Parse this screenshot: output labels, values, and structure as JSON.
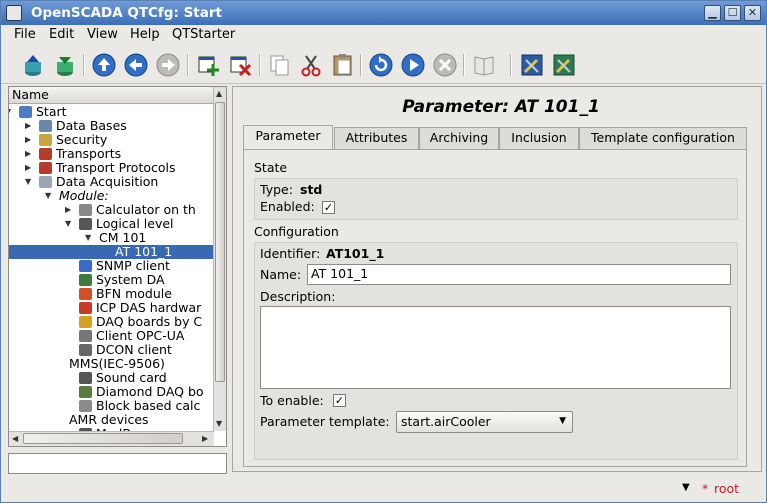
{
  "window": {
    "title": "OpenSCADA QTCfg: Start",
    "min": "▁",
    "max": "☐",
    "close": "✕"
  },
  "menu": [
    "File",
    "Edit",
    "View",
    "Help",
    "QTStarter"
  ],
  "toolbar": {
    "icons": [
      "db-load-icon",
      "db-save-icon",
      "up-icon",
      "back-icon",
      "forward-icon",
      "add-icon",
      "delete-icon",
      "copy-icon",
      "cut-icon",
      "paste-icon",
      "refresh-icon",
      "start-icon",
      "stop-icon",
      "manual-icon",
      "tool-icon-1",
      "tool-icon-2"
    ]
  },
  "tree": {
    "header": "Name",
    "rows": [
      {
        "text": "Start",
        "level": 0,
        "exp": "▼",
        "icon": "#4a7ac0"
      },
      {
        "text": "Data Bases",
        "level": 1,
        "exp": "▶",
        "icon": "#6a86a8"
      },
      {
        "text": "Security",
        "level": 1,
        "exp": "▶",
        "icon": "#c9a440"
      },
      {
        "text": "Transports",
        "level": 1,
        "exp": "▶",
        "icon": "#b83a2a"
      },
      {
        "text": "Transport Protocols",
        "level": 1,
        "exp": "▶",
        "icon": "#b83a2a"
      },
      {
        "text": "Data Acquisition",
        "level": 1,
        "exp": "▼",
        "icon": "#9aa6b4"
      },
      {
        "text": "Module:",
        "level": 2,
        "exp": "▼",
        "icon": "",
        "italic": true
      },
      {
        "text": "Calculator on th",
        "level": 3,
        "exp": "▶",
        "icon": "#888"
      },
      {
        "text": "Logical level",
        "level": 3,
        "exp": "▼",
        "icon": "#555"
      },
      {
        "text": "CM 101",
        "level": 4,
        "exp": "▼",
        "icon": ""
      },
      {
        "text": "AT 101_1",
        "level": 5,
        "exp": "",
        "icon": "",
        "selected": true
      },
      {
        "text": "SNMP client",
        "level": 3,
        "exp": "",
        "icon": "#3a6ac8"
      },
      {
        "text": "System DA",
        "level": 3,
        "exp": "",
        "icon": "#3e7a3e"
      },
      {
        "text": "BFN module",
        "level": 3,
        "exp": "",
        "icon": "#d0502a"
      },
      {
        "text": "ICP DAS hardwar",
        "level": 3,
        "exp": "",
        "icon": "#c83a2a"
      },
      {
        "text": "DAQ boards by C",
        "level": 3,
        "exp": "",
        "icon": "#d8a020"
      },
      {
        "text": "Client OPC-UA",
        "level": 3,
        "exp": "",
        "icon": "#777"
      },
      {
        "text": "DCON client",
        "level": 3,
        "exp": "",
        "icon": "#666"
      },
      {
        "text": "MMS(IEC-9506)",
        "level": 2.5,
        "exp": "",
        "icon": ""
      },
      {
        "text": "Sound card",
        "level": 3,
        "exp": "",
        "icon": "#555"
      },
      {
        "text": "Diamond DAQ bo",
        "level": 3,
        "exp": "",
        "icon": "#5a7a40"
      },
      {
        "text": "Block based calc",
        "level": 3,
        "exp": "",
        "icon": "#8a8a8a"
      },
      {
        "text": "AMR devices",
        "level": 2.5,
        "exp": "",
        "icon": ""
      },
      {
        "text": "ModBus",
        "level": 3,
        "exp": "",
        "icon": "#555"
      }
    ]
  },
  "panel": {
    "title": "Parameter: AT 101_1",
    "tabs": [
      "Parameter",
      "Attributes",
      "Archiving",
      "Inclusion",
      "Template configuration"
    ],
    "state": {
      "section": "State",
      "type_label": "Type:",
      "type_value": "std",
      "enabled_label": "Enabled:",
      "enabled": "✓"
    },
    "config": {
      "section": "Configuration",
      "id_label": "Identifier:",
      "id_value": "AT101_1",
      "name_label": "Name:",
      "name_value": "AT 101_1",
      "descr_label": "Description:",
      "descr_value": "",
      "to_enable_label": "To enable:",
      "to_enable": "✓",
      "template_label": "Parameter template:",
      "template_value": "start.airCooler"
    }
  },
  "status": {
    "arrow": "▼",
    "user_mark": "*",
    "user": "root",
    "user_color": "#c81e1e"
  }
}
